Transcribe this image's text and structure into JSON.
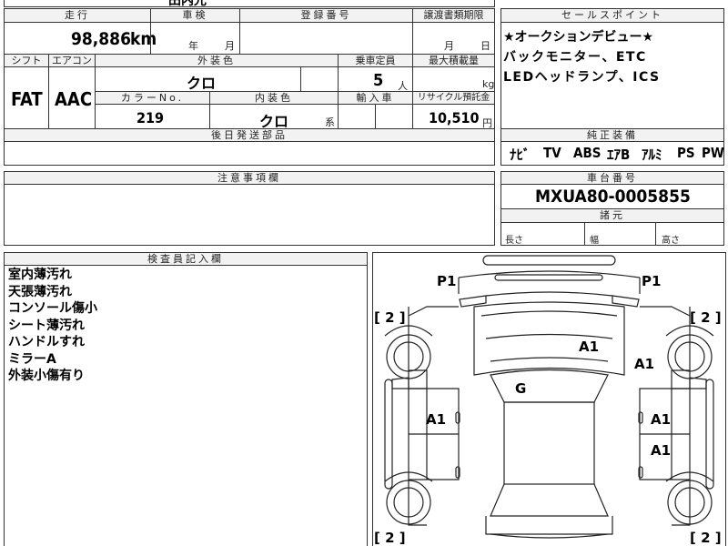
{
  "header": {
    "mileage_label": "走行",
    "inspection_label": "車検",
    "registration_label": "登録番号",
    "transfer_deadline_label": "譲渡書類期限",
    "mileage_value": "98,886",
    "mileage_unit": "km",
    "year_unit": "年",
    "month_unit": "月",
    "transfer_month_unit": "月",
    "transfer_day_unit": "日",
    "top_cut_text": "田内光"
  },
  "specs": {
    "shift_label": "シフト",
    "aircon_label": "エアコン",
    "exterior_color_label": "外装色",
    "capacity_label": "乗車定員",
    "max_load_label": "最大積載量",
    "shift_value": "FAT",
    "aircon_value": "AAC",
    "exterior_color_value": "クロ",
    "capacity_value": "5",
    "capacity_unit": "人",
    "load_unit": "kg",
    "color_no_label": "カラーNo.",
    "interior_color_label": "内装色",
    "import_label": "輸入車",
    "recycle_label": "リサイクル預託金",
    "color_no_value": "219",
    "interior_color_value": "クロ",
    "interior_color_suffix": "系",
    "recycle_value": "10,510",
    "recycle_unit": "円",
    "later_parts_label": "後日発送部品"
  },
  "sales_points": {
    "label": "セールスポイント",
    "lines": [
      "★オークションデビュー★",
      "バックモニター、ETC",
      "LEDヘッドランプ、ICS"
    ]
  },
  "equipment": {
    "label": "純正装備",
    "items": [
      "ﾅﾋﾞ",
      "TV",
      "ABS",
      "ｴｱB",
      "ｱﾙﾐ",
      "PS",
      "PW"
    ]
  },
  "caution": {
    "label": "注意事項欄"
  },
  "chassis": {
    "label": "車台番号",
    "value": "MXUA80-0005855",
    "dimensions_label": "諸元",
    "length_label": "長さ",
    "width_label": "幅",
    "height_label": "高さ"
  },
  "inspector_notes": {
    "label": "検査員記入欄",
    "lines": [
      "室内薄汚れ",
      "天張薄汚れ",
      "コンソール傷小",
      "シート薄汚れ",
      "ハンドルすれ",
      "ミラーA",
      "外装小傷有り"
    ]
  },
  "diagram": {
    "marks": {
      "p1_left": "P1",
      "p1_right": "P1",
      "a1_hood": "A1",
      "a1_fender_right": "A1",
      "g_windshield": "G",
      "a1_door_left": "A1",
      "a1_door_right_front": "A1",
      "a1_door_right_rear": "A1"
    },
    "tires": {
      "front_left": "[ 2 ]",
      "front_right": "[ 2 ]",
      "rear_left": "[ 2 ]",
      "rear_right": "[ 2 ]"
    }
  }
}
